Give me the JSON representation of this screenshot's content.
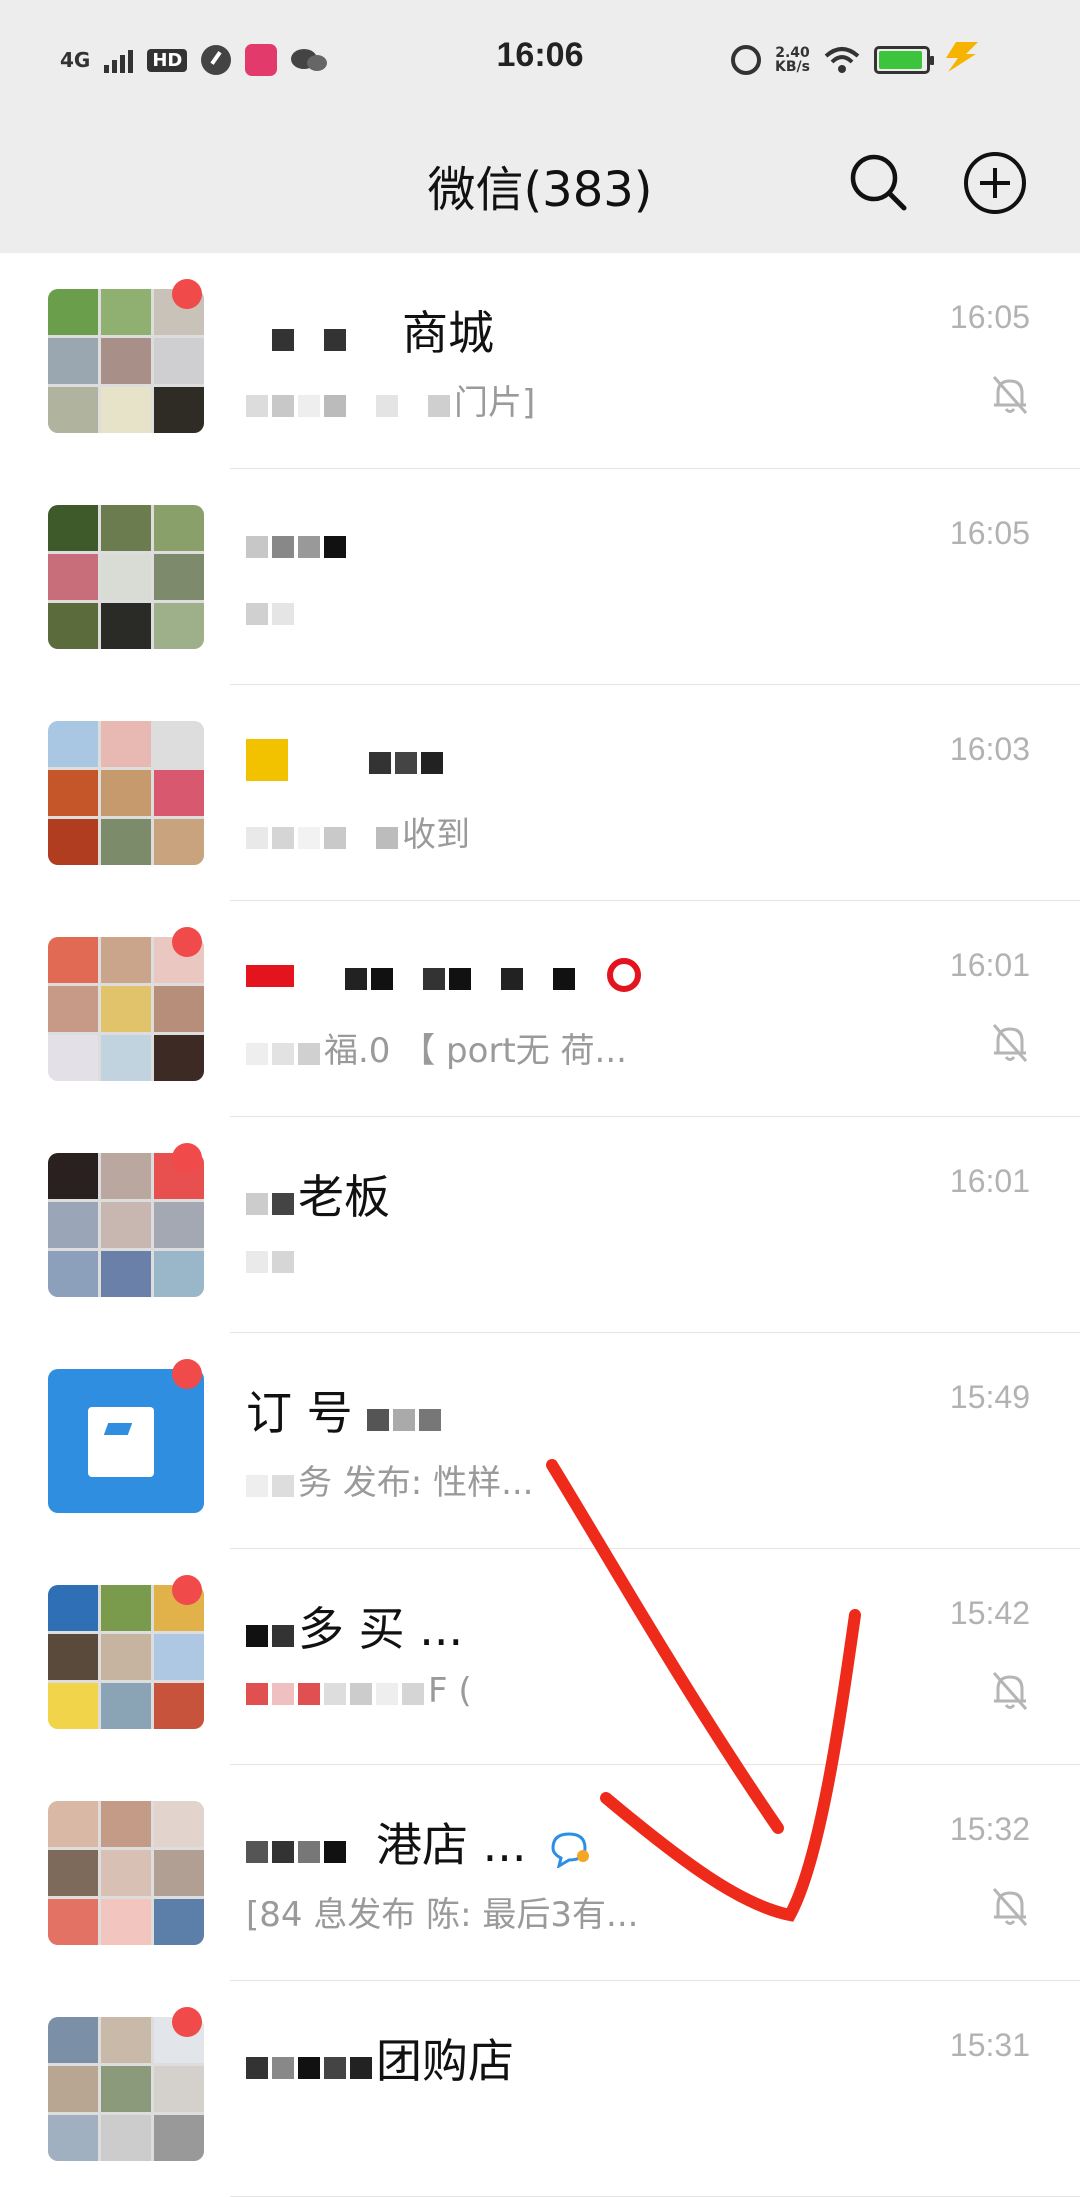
{
  "status_bar": {
    "network": "4G",
    "hd": "HD",
    "time": "16:06",
    "speed_value": "2.40",
    "speed_unit": "KB/s",
    "battery_level": 0.85,
    "battery_color": "#3cc53c"
  },
  "header": {
    "title": "微信(383)",
    "search_icon": "search-icon",
    "add_icon": "plus-circle-icon"
  },
  "chats": [
    {
      "name": "商城",
      "preview": "门片]",
      "time": "16:05",
      "muted": true,
      "unread": true
    },
    {
      "name": "",
      "preview": "",
      "time": "16:05",
      "muted": false,
      "unread": false
    },
    {
      "name": "",
      "preview": "收到",
      "time": "16:03",
      "muted": false,
      "unread": false
    },
    {
      "name": "",
      "preview": "福.0 【 port无 荷...",
      "time": "16:01",
      "muted": true,
      "unread": true
    },
    {
      "name": "老板",
      "preview": "",
      "time": "16:01",
      "muted": false,
      "unread": true
    },
    {
      "name": "订 号",
      "preview": "务 发布: 性样...",
      "time": "15:49",
      "muted": false,
      "unread": true
    },
    {
      "name": "多 买 ...",
      "preview": "F ( ",
      "time": "15:42",
      "muted": true,
      "unread": true
    },
    {
      "name": "港店 ...",
      "preview": "[84 息发布 陈: 最后3有...",
      "time": "15:32",
      "muted": true,
      "unread": false
    },
    {
      "name": "团购店",
      "preview": "",
      "time": "15:31",
      "muted": false,
      "unread": true
    }
  ],
  "colors": {
    "header_bg": "#ededed",
    "unread_dot": "#f04a4a",
    "annotation_stroke": "#ee2a1b",
    "time_text": "#b2b2b2"
  }
}
